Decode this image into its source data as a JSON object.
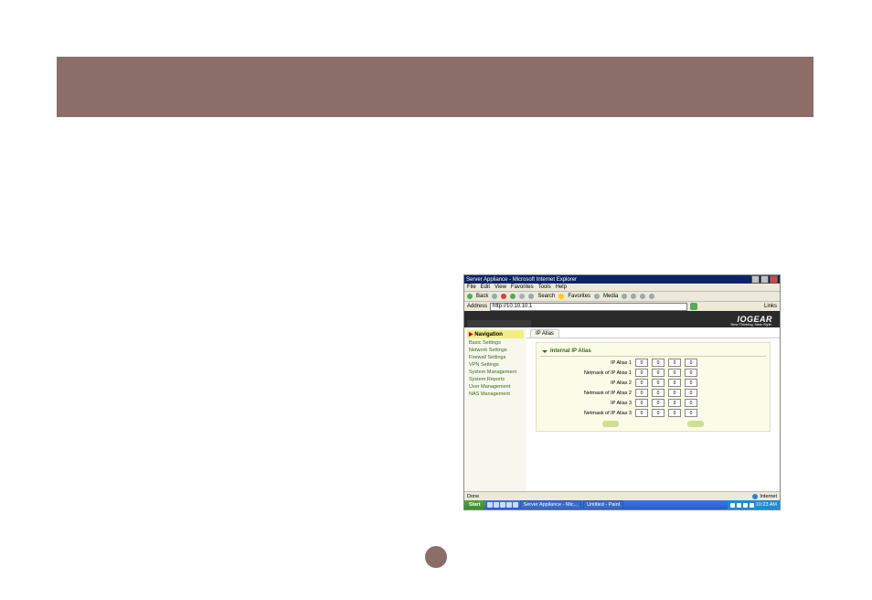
{
  "browser": {
    "window_title": "Server Appliance - Microsoft Internet Explorer",
    "menu": [
      "File",
      "Edit",
      "View",
      "Favorites",
      "Tools",
      "Help"
    ],
    "toolbar": {
      "back": "Back",
      "search": "Search",
      "favorites": "Favorites",
      "media": "Media"
    },
    "address_label": "Address",
    "address_value": "http://10.10.10.1",
    "links_label": "Links"
  },
  "brand": {
    "logo_text": "IOGEAR",
    "tagline": "New Thinking. New Style."
  },
  "sidebar": {
    "title": "Navigation",
    "items": [
      "Basic Settings",
      "Network Settings",
      "Firewall Settings",
      "VPN Settings",
      "System Management",
      "System Reports",
      "User Management",
      "NAS Management"
    ]
  },
  "tabs": {
    "active": "IP Alias"
  },
  "form": {
    "heading": "Internal IP Alias",
    "rows": [
      {
        "label": "IP Alias 1",
        "v": [
          "0",
          "0",
          "0",
          "0"
        ]
      },
      {
        "label": "Netmask of IP Alias 1",
        "v": [
          "0",
          "0",
          "0",
          "0"
        ]
      },
      {
        "label": "IP Alias 2",
        "v": [
          "0",
          "0",
          "0",
          "0"
        ]
      },
      {
        "label": "Netmask of IP Alias 2",
        "v": [
          "0",
          "0",
          "0",
          "0"
        ]
      },
      {
        "label": "IP Alias 3",
        "v": [
          "0",
          "0",
          "0",
          "0"
        ]
      },
      {
        "label": "Netmask of IP Alias 3",
        "v": [
          "0",
          "0",
          "0",
          "0"
        ]
      }
    ]
  },
  "statusbar": {
    "left": "Done",
    "right": "Internet"
  },
  "taskbar": {
    "start": "Start",
    "tasks": [
      "Server Appliance - Mic...",
      "Untitled - Paint"
    ],
    "clock": "10:23 AM"
  }
}
